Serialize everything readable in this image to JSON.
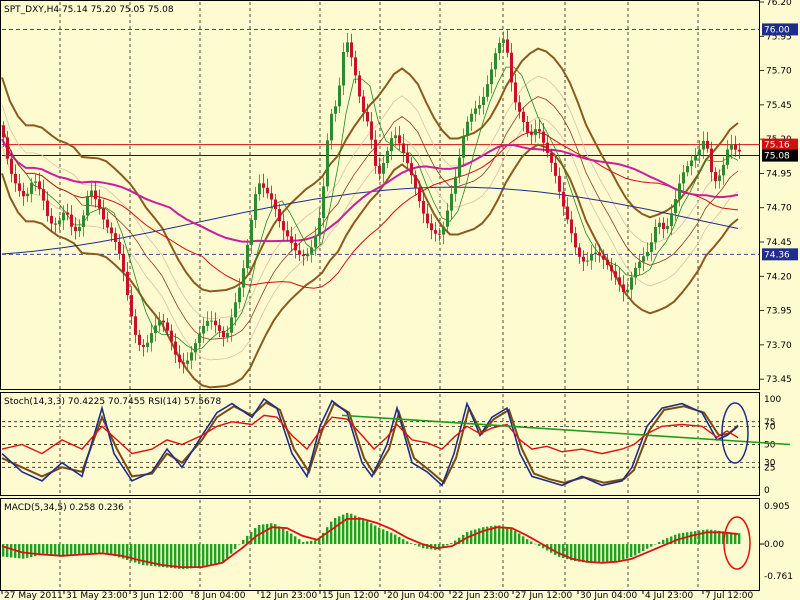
{
  "colors": {
    "background": "#FFFBD0",
    "bull_candle": "#2D8A2D",
    "bear_candle": "#C8102E",
    "outer_band": "#8B5A1E",
    "ma_magenta": "#C81EA0",
    "ma_navy": "#1E2D8C",
    "ma_red": "#D01010",
    "stoch_main": "#1E2D8C",
    "stoch_signal": "#7A4A10",
    "rsi": "#E01010",
    "trendline": "#1E9A1E",
    "macd_hist": "#20A020",
    "macd_signal": "#E01010",
    "hline_blue": "#1E2D8C",
    "highlight_circle_blue": "#1E2D8C",
    "highlight_circle_red": "#E01010"
  },
  "chart_data": [
    {
      "type": "candlestick",
      "title": "SPT_DXY,H4  75.14 75.20 75.05 75.08",
      "symbol": "SPT_DXY",
      "timeframe": "H4",
      "ohlc_last": {
        "open": 75.14,
        "high": 75.2,
        "low": 75.05,
        "close": 75.08
      },
      "x_tick_labels": [
        "27 May 2011",
        "31 May 23:00",
        "3 Jun 12:00",
        "8 Jun 04:00",
        "12 Jun 23:00",
        "15 Jun 12:00",
        "20 Jun 04:00",
        "22 Jun 23:00",
        "27 Jun 12:00",
        "30 Jun 04:00",
        "4 Jul 23:00",
        "7 Jul 12:00"
      ],
      "ylim": [
        73.4,
        76.2
      ],
      "y_ticks": [
        "76.20",
        "75.95",
        "75.70",
        "75.45",
        "75.20",
        "74.95",
        "74.70",
        "74.45",
        "74.20",
        "73.95",
        "73.70",
        "73.45"
      ],
      "price_tags": [
        {
          "label": "76.00",
          "value": 76.0,
          "style": "blue"
        },
        {
          "label": "75.16",
          "value": 75.16,
          "style": "red"
        },
        {
          "label": "75.08",
          "value": 75.08,
          "style": "black"
        },
        {
          "label": "74.36",
          "value": 74.36,
          "style": "blue"
        }
      ],
      "close_path": [
        [
          0,
          75.3
        ],
        [
          8,
          74.95
        ],
        [
          16,
          74.8
        ],
        [
          24,
          74.75
        ],
        [
          32,
          74.95
        ],
        [
          40,
          74.85
        ],
        [
          48,
          74.6
        ],
        [
          56,
          74.55
        ],
        [
          64,
          74.65
        ],
        [
          72,
          74.5
        ],
        [
          80,
          74.6
        ],
        [
          88,
          74.9
        ],
        [
          96,
          74.75
        ],
        [
          104,
          74.55
        ],
        [
          112,
          74.45
        ],
        [
          120,
          74.3
        ],
        [
          128,
          74.0
        ],
        [
          136,
          73.75
        ],
        [
          144,
          73.7
        ],
        [
          152,
          73.8
        ],
        [
          160,
          73.85
        ],
        [
          168,
          73.75
        ],
        [
          176,
          73.6
        ],
        [
          184,
          73.6
        ],
        [
          192,
          73.7
        ],
        [
          200,
          73.8
        ],
        [
          208,
          73.85
        ],
        [
          216,
          73.8
        ],
        [
          224,
          73.75
        ],
        [
          232,
          74.0
        ],
        [
          240,
          74.2
        ],
        [
          248,
          74.5
        ],
        [
          256,
          74.85
        ],
        [
          264,
          74.8
        ],
        [
          272,
          74.75
        ],
        [
          280,
          74.6
        ],
        [
          288,
          74.5
        ],
        [
          296,
          74.35
        ],
        [
          304,
          74.3
        ],
        [
          312,
          74.4
        ],
        [
          320,
          74.7
        ],
        [
          328,
          75.4
        ],
        [
          336,
          75.5
        ],
        [
          344,
          75.95
        ],
        [
          352,
          75.7
        ],
        [
          360,
          75.4
        ],
        [
          368,
          75.3
        ],
        [
          376,
          74.95
        ],
        [
          384,
          75.1
        ],
        [
          392,
          75.25
        ],
        [
          400,
          75.1
        ],
        [
          408,
          74.95
        ],
        [
          416,
          74.8
        ],
        [
          424,
          74.65
        ],
        [
          432,
          74.55
        ],
        [
          440,
          74.5
        ],
        [
          448,
          74.7
        ],
        [
          456,
          74.95
        ],
        [
          464,
          75.3
        ],
        [
          472,
          75.45
        ],
        [
          480,
          75.5
        ],
        [
          488,
          75.65
        ],
        [
          496,
          75.85
        ],
        [
          504,
          75.9
        ],
        [
          512,
          75.5
        ],
        [
          520,
          75.4
        ],
        [
          528,
          75.25
        ],
        [
          536,
          75.3
        ],
        [
          544,
          75.1
        ],
        [
          552,
          74.95
        ],
        [
          560,
          74.75
        ],
        [
          568,
          74.6
        ],
        [
          576,
          74.4
        ],
        [
          584,
          74.3
        ],
        [
          592,
          74.35
        ],
        [
          600,
          74.3
        ],
        [
          608,
          74.25
        ],
        [
          616,
          74.2
        ],
        [
          624,
          74.1
        ],
        [
          632,
          74.25
        ],
        [
          640,
          74.3
        ],
        [
          648,
          74.35
        ],
        [
          656,
          74.6
        ],
        [
          664,
          74.55
        ],
        [
          672,
          74.75
        ],
        [
          680,
          74.95
        ],
        [
          688,
          75.0
        ],
        [
          696,
          75.05
        ],
        [
          704,
          75.2
        ],
        [
          712,
          74.9
        ],
        [
          720,
          75.0
        ],
        [
          728,
          75.2
        ],
        [
          736,
          75.08
        ]
      ]
    },
    {
      "type": "line",
      "title": "Stoch(14,3,3) 70.4225 70.7455  RSI(14) 57.5678",
      "stoch_k_last": 70.4225,
      "stoch_d_last": 70.7455,
      "rsi_last": 57.5678,
      "y_ticks": [
        "100",
        "75",
        "70",
        "50",
        "30",
        "25",
        "0"
      ],
      "levels": [
        75,
        70,
        50,
        30,
        25
      ],
      "ylim": [
        0,
        100
      ],
      "stoch_k": [
        [
          0,
          40
        ],
        [
          20,
          20
        ],
        [
          40,
          10
        ],
        [
          60,
          30
        ],
        [
          80,
          15
        ],
        [
          100,
          90
        ],
        [
          112,
          40
        ],
        [
          130,
          10
        ],
        [
          150,
          20
        ],
        [
          165,
          45
        ],
        [
          180,
          25
        ],
        [
          200,
          60
        ],
        [
          215,
          85
        ],
        [
          230,
          95
        ],
        [
          250,
          80
        ],
        [
          262,
          100
        ],
        [
          275,
          90
        ],
        [
          290,
          40
        ],
        [
          305,
          15
        ],
        [
          318,
          70
        ],
        [
          330,
          98
        ],
        [
          345,
          85
        ],
        [
          360,
          30
        ],
        [
          370,
          15
        ],
        [
          385,
          50
        ],
        [
          395,
          90
        ],
        [
          410,
          30
        ],
        [
          425,
          20
        ],
        [
          440,
          5
        ],
        [
          452,
          40
        ],
        [
          465,
          95
        ],
        [
          478,
          60
        ],
        [
          490,
          80
        ],
        [
          505,
          90
        ],
        [
          518,
          40
        ],
        [
          530,
          15
        ],
        [
          545,
          10
        ],
        [
          560,
          5
        ],
        [
          580,
          15
        ],
        [
          600,
          5
        ],
        [
          620,
          10
        ],
        [
          630,
          25
        ],
        [
          645,
          70
        ],
        [
          660,
          90
        ],
        [
          680,
          95
        ],
        [
          700,
          85
        ],
        [
          715,
          55
        ],
        [
          725,
          60
        ],
        [
          736,
          70
        ]
      ],
      "stoch_d": [
        [
          0,
          35
        ],
        [
          20,
          25
        ],
        [
          40,
          15
        ],
        [
          60,
          25
        ],
        [
          80,
          20
        ],
        [
          100,
          80
        ],
        [
          115,
          45
        ],
        [
          130,
          15
        ],
        [
          150,
          18
        ],
        [
          165,
          40
        ],
        [
          180,
          30
        ],
        [
          200,
          55
        ],
        [
          215,
          80
        ],
        [
          232,
          92
        ],
        [
          250,
          82
        ],
        [
          264,
          96
        ],
        [
          278,
          88
        ],
        [
          292,
          45
        ],
        [
          307,
          20
        ],
        [
          320,
          65
        ],
        [
          332,
          95
        ],
        [
          347,
          85
        ],
        [
          362,
          35
        ],
        [
          372,
          18
        ],
        [
          387,
          45
        ],
        [
          397,
          85
        ],
        [
          412,
          35
        ],
        [
          427,
          22
        ],
        [
          442,
          8
        ],
        [
          454,
          35
        ],
        [
          467,
          90
        ],
        [
          480,
          62
        ],
        [
          492,
          78
        ],
        [
          507,
          88
        ],
        [
          520,
          45
        ],
        [
          532,
          18
        ],
        [
          547,
          12
        ],
        [
          562,
          8
        ],
        [
          582,
          14
        ],
        [
          602,
          8
        ],
        [
          622,
          12
        ],
        [
          632,
          22
        ],
        [
          647,
          65
        ],
        [
          662,
          88
        ],
        [
          682,
          92
        ],
        [
          702,
          85
        ],
        [
          717,
          60
        ],
        [
          727,
          62
        ],
        [
          736,
          71
        ]
      ],
      "rsi": [
        [
          0,
          45
        ],
        [
          20,
          50
        ],
        [
          40,
          40
        ],
        [
          60,
          55
        ],
        [
          80,
          45
        ],
        [
          100,
          70
        ],
        [
          115,
          55
        ],
        [
          130,
          40
        ],
        [
          150,
          45
        ],
        [
          165,
          55
        ],
        [
          180,
          50
        ],
        [
          200,
          60
        ],
        [
          215,
          70
        ],
        [
          230,
          75
        ],
        [
          250,
          72
        ],
        [
          262,
          82
        ],
        [
          275,
          80
        ],
        [
          290,
          60
        ],
        [
          305,
          45
        ],
        [
          318,
          65
        ],
        [
          330,
          80
        ],
        [
          345,
          78
        ],
        [
          360,
          60
        ],
        [
          372,
          45
        ],
        [
          385,
          58
        ],
        [
          395,
          72
        ],
        [
          410,
          55
        ],
        [
          425,
          52
        ],
        [
          440,
          45
        ],
        [
          452,
          58
        ],
        [
          465,
          70
        ],
        [
          478,
          62
        ],
        [
          490,
          68
        ],
        [
          505,
          72
        ],
        [
          518,
          55
        ],
        [
          530,
          45
        ],
        [
          545,
          48
        ],
        [
          560,
          42
        ],
        [
          580,
          45
        ],
        [
          600,
          40
        ],
        [
          620,
          45
        ],
        [
          632,
          50
        ],
        [
          645,
          62
        ],
        [
          660,
          70
        ],
        [
          680,
          72
        ],
        [
          700,
          70
        ],
        [
          715,
          58
        ],
        [
          725,
          65
        ],
        [
          736,
          57.57
        ]
      ],
      "trendline": [
        [
          340,
          82
        ],
        [
          790,
          50
        ]
      ]
    },
    {
      "type": "bar",
      "title": "MACD(5,34,5) 0.258 0.236",
      "macd_last": 0.258,
      "signal_last": 0.236,
      "ylim": [
        -0.761,
        0.905
      ],
      "y_ticks": [
        "0.905",
        "0.00",
        "-0.761"
      ],
      "histogram": [
        [
          0,
          -0.3
        ],
        [
          20,
          -0.35
        ],
        [
          40,
          -0.25
        ],
        [
          60,
          -0.3
        ],
        [
          80,
          -0.25
        ],
        [
          100,
          -0.2
        ],
        [
          120,
          -0.35
        ],
        [
          140,
          -0.5
        ],
        [
          160,
          -0.55
        ],
        [
          180,
          -0.6
        ],
        [
          200,
          -0.55
        ],
        [
          220,
          -0.45
        ],
        [
          240,
          0.1
        ],
        [
          255,
          0.45
        ],
        [
          270,
          0.5
        ],
        [
          285,
          0.3
        ],
        [
          300,
          0.05
        ],
        [
          315,
          0.1
        ],
        [
          330,
          0.6
        ],
        [
          345,
          0.75
        ],
        [
          360,
          0.6
        ],
        [
          375,
          0.4
        ],
        [
          390,
          0.25
        ],
        [
          405,
          0.05
        ],
        [
          420,
          -0.1
        ],
        [
          435,
          -0.15
        ],
        [
          450,
          0.05
        ],
        [
          465,
          0.3
        ],
        [
          480,
          0.4
        ],
        [
          495,
          0.45
        ],
        [
          510,
          0.35
        ],
        [
          525,
          0.1
        ],
        [
          540,
          -0.1
        ],
        [
          555,
          -0.3
        ],
        [
          570,
          -0.4
        ],
        [
          585,
          -0.45
        ],
        [
          600,
          -0.45
        ],
        [
          615,
          -0.4
        ],
        [
          630,
          -0.3
        ],
        [
          645,
          -0.1
        ],
        [
          660,
          0.1
        ],
        [
          675,
          0.25
        ],
        [
          690,
          0.3
        ],
        [
          705,
          0.35
        ],
        [
          720,
          0.3
        ],
        [
          736,
          0.258
        ]
      ],
      "signal": [
        [
          0,
          -0.05
        ],
        [
          20,
          -0.2
        ],
        [
          40,
          -0.25
        ],
        [
          60,
          -0.28
        ],
        [
          80,
          -0.25
        ],
        [
          100,
          -0.22
        ],
        [
          120,
          -0.28
        ],
        [
          140,
          -0.4
        ],
        [
          160,
          -0.5
        ],
        [
          180,
          -0.55
        ],
        [
          200,
          -0.55
        ],
        [
          220,
          -0.45
        ],
        [
          240,
          -0.1
        ],
        [
          255,
          0.2
        ],
        [
          270,
          0.4
        ],
        [
          285,
          0.38
        ],
        [
          300,
          0.2
        ],
        [
          315,
          0.1
        ],
        [
          330,
          0.35
        ],
        [
          345,
          0.6
        ],
        [
          360,
          0.6
        ],
        [
          375,
          0.5
        ],
        [
          390,
          0.35
        ],
        [
          405,
          0.15
        ],
        [
          420,
          0.0
        ],
        [
          435,
          -0.1
        ],
        [
          450,
          -0.05
        ],
        [
          465,
          0.15
        ],
        [
          480,
          0.3
        ],
        [
          495,
          0.4
        ],
        [
          510,
          0.38
        ],
        [
          525,
          0.2
        ],
        [
          540,
          0.0
        ],
        [
          555,
          -0.2
        ],
        [
          570,
          -0.35
        ],
        [
          585,
          -0.42
        ],
        [
          600,
          -0.45
        ],
        [
          615,
          -0.42
        ],
        [
          630,
          -0.35
        ],
        [
          645,
          -0.2
        ],
        [
          660,
          -0.05
        ],
        [
          675,
          0.1
        ],
        [
          690,
          0.2
        ],
        [
          705,
          0.28
        ],
        [
          720,
          0.28
        ],
        [
          736,
          0.236
        ]
      ]
    }
  ]
}
